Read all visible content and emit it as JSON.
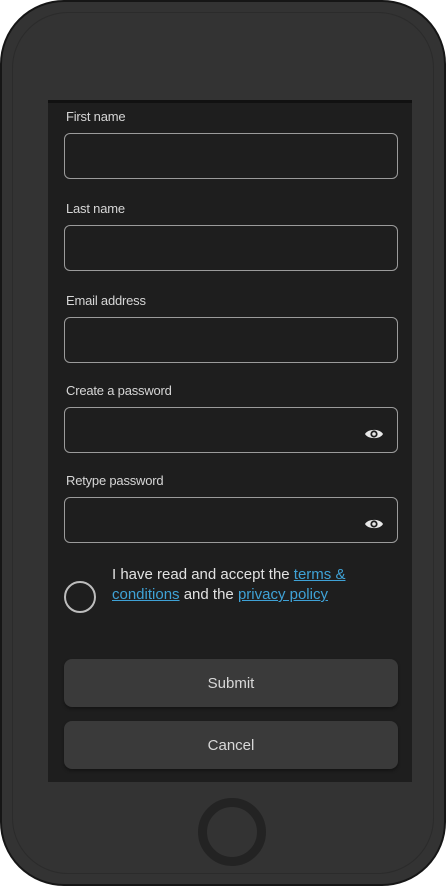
{
  "form": {
    "first_name": {
      "label": "First name",
      "value": ""
    },
    "last_name": {
      "label": "Last name",
      "value": ""
    },
    "email": {
      "label": "Email address",
      "value": ""
    },
    "password": {
      "label": "Create a password",
      "value": ""
    },
    "retype_password": {
      "label": "Retype password",
      "value": ""
    },
    "consent": {
      "text_before": "I have read and accept the ",
      "terms_link": "terms & conditions",
      "text_middle": " and the ",
      "privacy_link": "privacy policy",
      "checked": false
    },
    "submit_label": "Submit",
    "cancel_label": "Cancel"
  },
  "icons": {
    "password_toggle": "eye-icon",
    "home": "home-button"
  },
  "colors": {
    "device_body": "#333333",
    "screen_background": "#1e1e1e",
    "link": "#3fa2d6",
    "button_background": "#3a3a3a",
    "input_border": "#9b9b9b"
  }
}
